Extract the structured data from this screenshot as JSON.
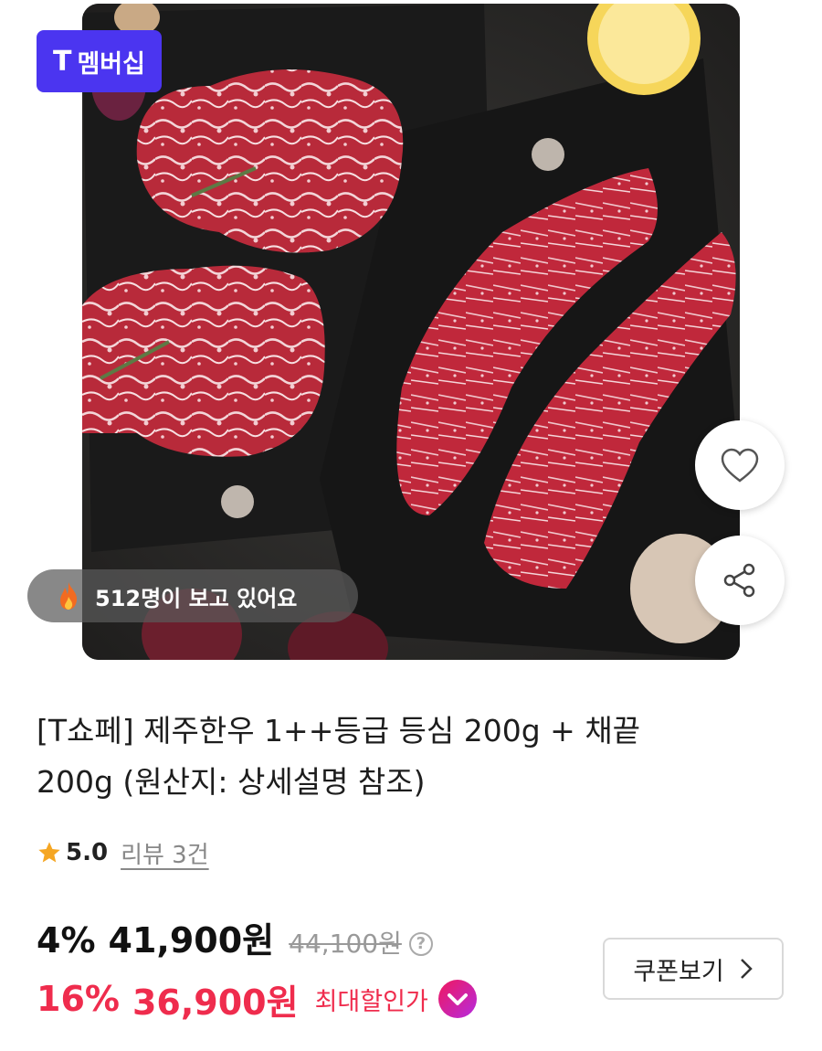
{
  "badge": {
    "icon": "T",
    "label": "멤버십"
  },
  "viewers": {
    "text": "512명이 보고 있어요"
  },
  "product": {
    "title_line1": "[T쇼페] 제주한우 1++등급 등심 200g + 채끝",
    "title_line2": "200g (원산지: 상세설명 참조)"
  },
  "rating": {
    "score": "5.0",
    "review": "리뷰 3건"
  },
  "price": {
    "discount1": "4%",
    "amount1": "41,900원",
    "original": "44,100원",
    "help": "?",
    "discount2": "16%",
    "amount2": "36,900원",
    "max_label": "최대할인가"
  },
  "coupon": {
    "label": "쿠폰보기"
  },
  "colors": {
    "brand": "#4b35f0",
    "sale": "#ef2c4d",
    "check": "#f0195e"
  }
}
